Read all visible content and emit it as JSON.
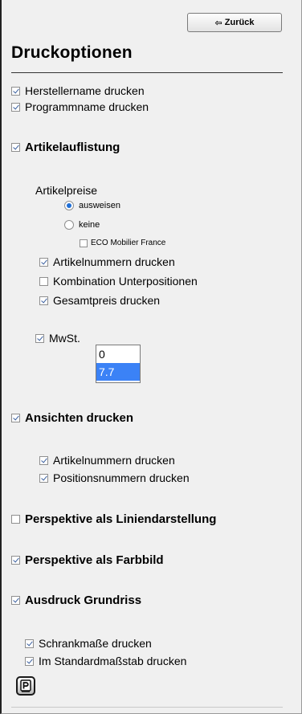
{
  "header": {
    "back_button": "Zurück",
    "back_icon": "⇦",
    "title": "Druckoptionen"
  },
  "options": {
    "herstellername": {
      "label": "Herstellername drucken",
      "checked": true
    },
    "programmname": {
      "label": "Programmname drucken",
      "checked": true
    },
    "artikelauflistung": {
      "label": "Artikelauflistung",
      "checked": true
    },
    "artikelpreise_label": "Artikelpreise",
    "preis_ausweisen": {
      "label": "ausweisen",
      "selected": true
    },
    "preis_keine": {
      "label": "keine",
      "selected": false
    },
    "eco_mobilier": {
      "label": "ECO Mobilier France",
      "checked": false
    },
    "artikelnummern": {
      "label": "Artikelnummern drucken",
      "checked": true
    },
    "kombination": {
      "label": "Kombination Unterpositionen",
      "checked": false
    },
    "gesamtpreis": {
      "label": "Gesamtpreis drucken",
      "checked": true
    },
    "mwst": {
      "label": "MwSt.",
      "checked": true
    },
    "mwst_options": [
      "0",
      "7.7"
    ],
    "mwst_selected": "7.7",
    "ansichten": {
      "label": "Ansichten drucken",
      "checked": true
    },
    "ansichten_artikelnummern": {
      "label": "Artikelnummern drucken",
      "checked": true
    },
    "ansichten_positionsnummern": {
      "label": "Positionsnummern drucken",
      "checked": true
    },
    "perspektive_linien": {
      "label": "Perspektive als Liniendarstellung",
      "checked": false
    },
    "perspektive_farbbild": {
      "label": "Perspektive als Farbbild",
      "checked": true
    },
    "grundriss": {
      "label": "Ausdruck Grundriss",
      "checked": true
    },
    "schrankmasse": {
      "label": "Schrankmaße drucken",
      "checked": true
    },
    "standardmassstab": {
      "label": "Im Standardmaßstab drucken",
      "checked": true
    }
  },
  "print_button": {
    "icon": "printer-icon",
    "glyph": "P"
  },
  "colors": {
    "background": "#f0f0f0",
    "accent": "#3b82f6",
    "check": "#3a5f9f"
  }
}
